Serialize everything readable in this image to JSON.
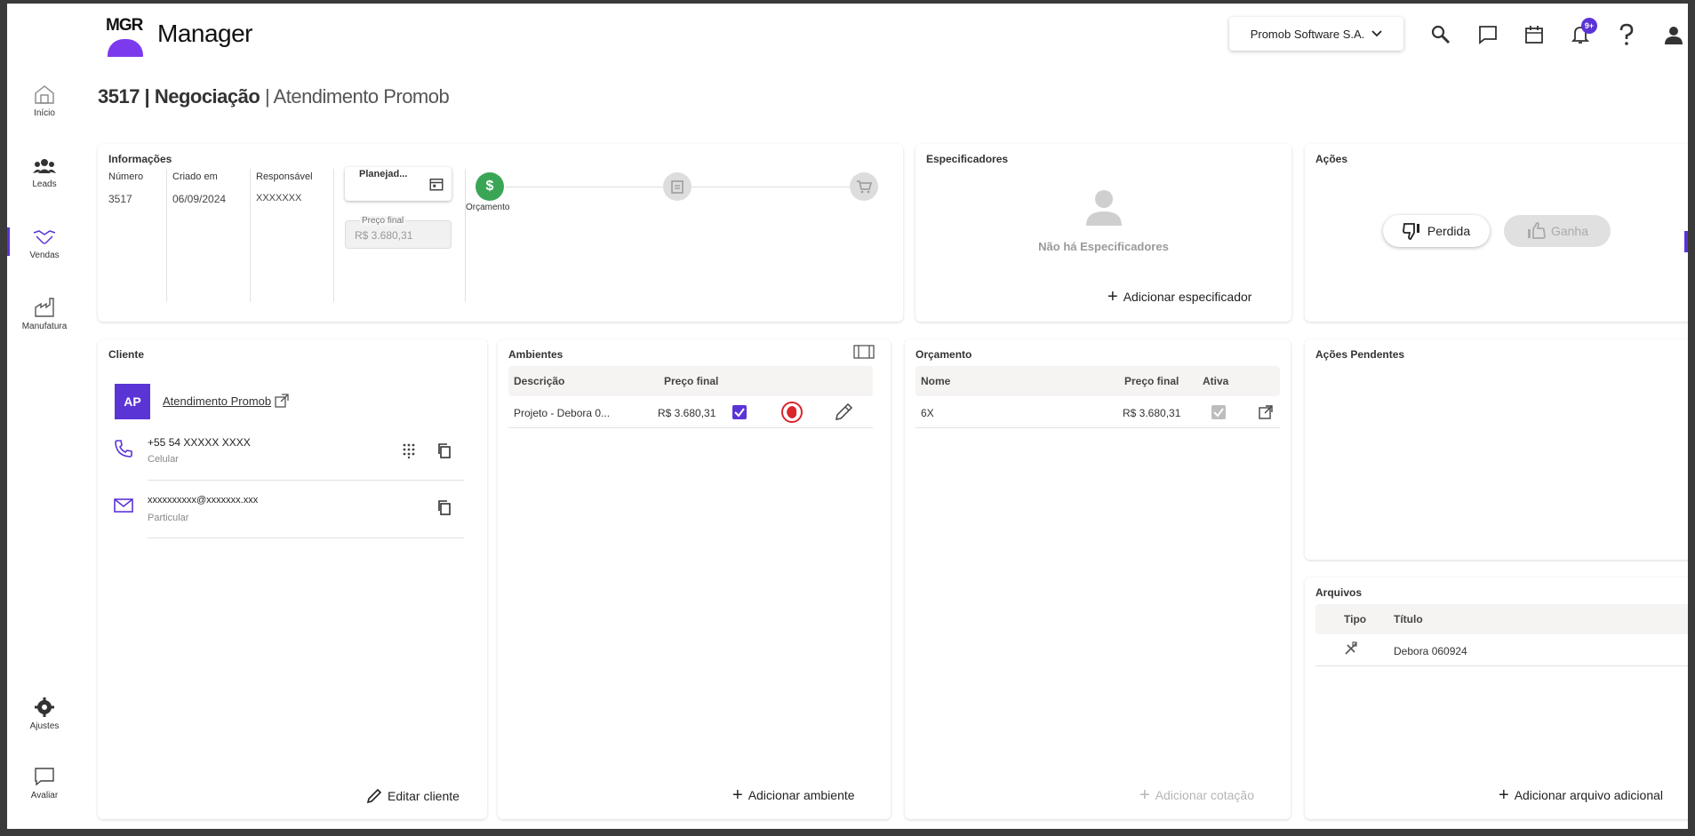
{
  "app": {
    "logo_text": "MGR",
    "title": "Manager"
  },
  "header": {
    "company": "Promob Software S.A.",
    "notifications_badge": "9+",
    "icons": [
      "search-icon",
      "chat-icon",
      "calendar-icon",
      "bell-icon",
      "help-icon",
      "user-icon"
    ]
  },
  "sidebar": {
    "items": [
      {
        "label": "Início",
        "icon": "home-icon"
      },
      {
        "label": "Leads",
        "icon": "people-icon"
      },
      {
        "label": "Vendas",
        "icon": "handshake-icon",
        "active": true
      },
      {
        "label": "Manufatura",
        "icon": "factory-icon"
      }
    ],
    "bottom": [
      {
        "label": "Ajustes",
        "icon": "gear-icon"
      },
      {
        "label": "Avaliar",
        "icon": "feedback-icon"
      }
    ]
  },
  "page": {
    "id_part": "3517 | Negociação",
    "subtitle_part": " | Atendimento Promob"
  },
  "info": {
    "title": "Informações",
    "numero_label": "Número",
    "numero_value": "3517",
    "criado_label": "Criado em",
    "criado_value": "06/09/2024",
    "responsavel_label": "Responsável",
    "responsavel_value": "XXXXXXX",
    "planejado_value": "Planejad...",
    "preco_label": "Preço final",
    "preco_value": "R$ 3.680,31",
    "stage_label": "Orçamento"
  },
  "specifiers": {
    "title": "Especificadores",
    "empty_text": "Não há Especificadores",
    "add_label": "Adicionar especificador"
  },
  "actions": {
    "title": "Ações",
    "lost_label": "Perdida",
    "won_label": "Ganha"
  },
  "client": {
    "title": "Cliente",
    "initials": "AP",
    "name": "Atendimento Promob",
    "phone": "+55 54 XXXXX XXXX",
    "phone_type": "Celular",
    "email": "xxxxxxxxxx@xxxxxxx.xxx",
    "email_type": "Particular",
    "edit_label": "Editar cliente"
  },
  "environments": {
    "title": "Ambientes",
    "col_desc": "Descrição",
    "col_price": "Preço final",
    "rows": [
      {
        "desc": "Projeto - Debora 0...",
        "price": "R$ 3.680,31"
      }
    ],
    "add_label": "Adicionar ambiente"
  },
  "budget": {
    "title": "Orçamento",
    "col_name": "Nome",
    "col_price": "Preço final",
    "col_active": "Ativa",
    "rows": [
      {
        "name": "6X",
        "price": "R$ 3.680,31"
      }
    ],
    "add_label": "Adicionar cotação"
  },
  "pending": {
    "title": "Ações Pendentes"
  },
  "files": {
    "title": "Arquivos",
    "col_type": "Tipo",
    "col_title": "Título",
    "rows": [
      {
        "title": "Debora 060924"
      }
    ],
    "add_label": "Adicionar arquivo adicional"
  },
  "colors": {
    "accent": "#5b34d6",
    "success": "#3aa655",
    "danger": "#d9262b"
  }
}
